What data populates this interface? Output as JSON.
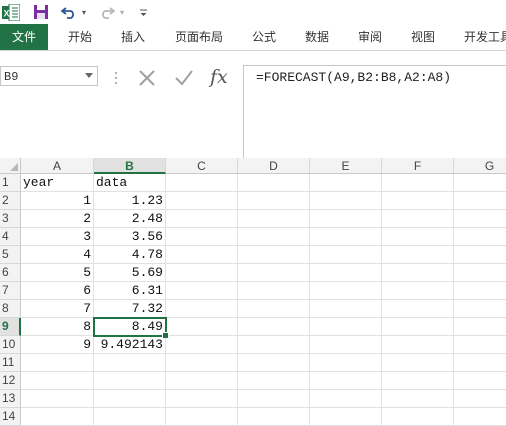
{
  "tabs": [
    "文件",
    "开始",
    "插入",
    "页面布局",
    "公式",
    "数据",
    "审阅",
    "视图",
    "开发工具"
  ],
  "name_box": "B9",
  "formula": "=FORECAST(A9,B2:B8,A2:A8)",
  "fx_label": "fx",
  "columns": [
    "A",
    "B",
    "C",
    "D",
    "E",
    "F",
    "G"
  ],
  "selected_column": "B",
  "rows": [
    "1",
    "2",
    "3",
    "4",
    "5",
    "6",
    "7",
    "8",
    "9",
    "10",
    "11",
    "12",
    "13",
    "14"
  ],
  "selected_row": "9",
  "cells": {
    "A1": "year",
    "B1": "data",
    "A2": "1",
    "B2": "1.23",
    "A3": "2",
    "B3": "2.48",
    "A4": "3",
    "B4": "3.56",
    "A5": "4",
    "B5": "4.78",
    "A6": "5",
    "B6": "5.69",
    "A7": "6",
    "B7": "6.31",
    "A8": "7",
    "B8": "7.32",
    "A9": "8",
    "B9": "8.49",
    "A10": "9",
    "B10": "9.492143"
  },
  "colors": {
    "accent": "#217346",
    "header_bg": "#f3f3f3"
  }
}
